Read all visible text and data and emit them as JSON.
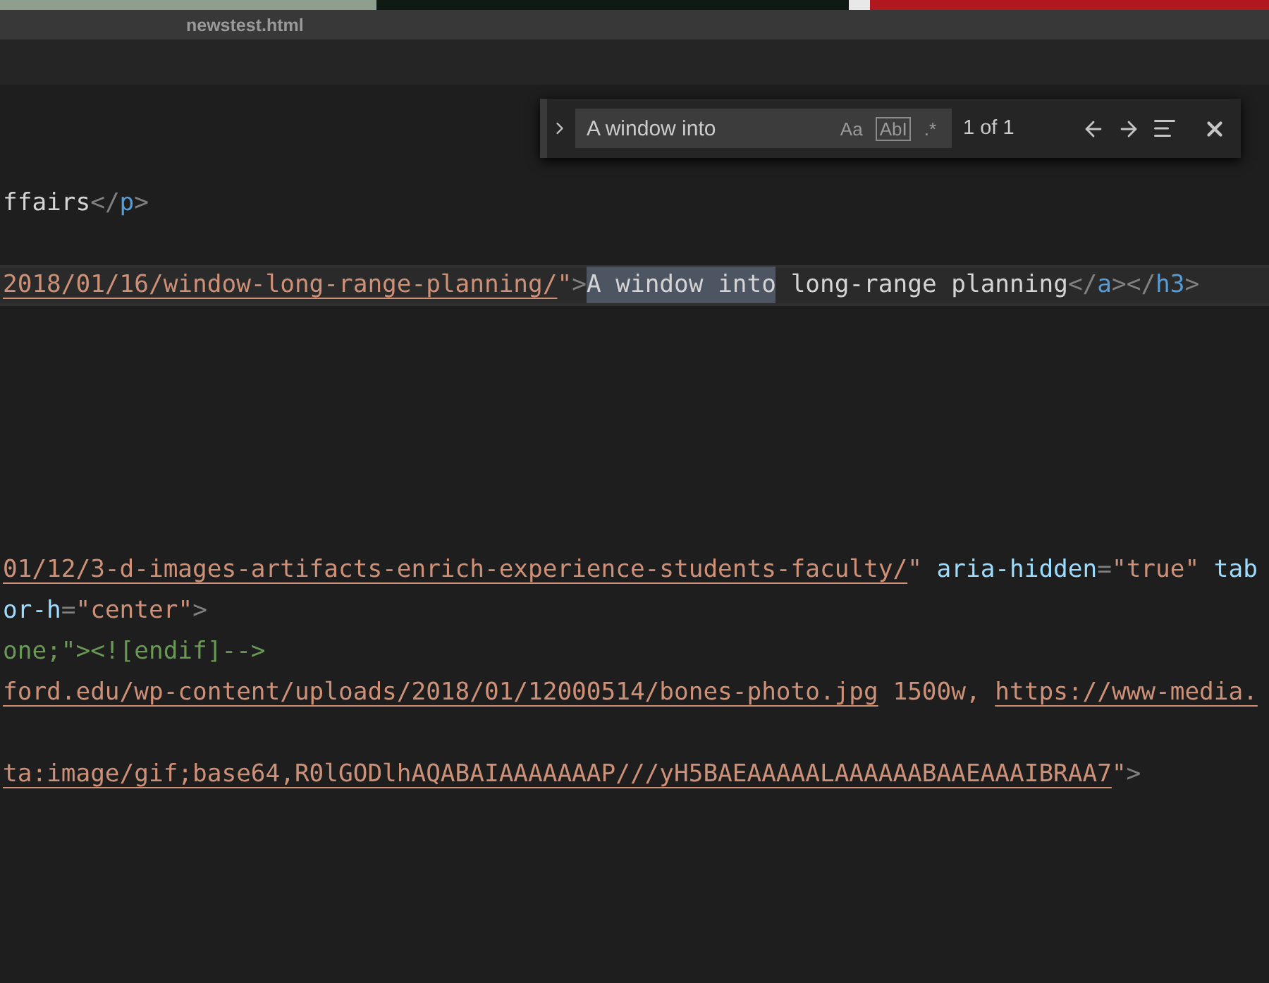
{
  "tab": {
    "title": "newstest.html"
  },
  "find": {
    "query": "A window into",
    "toggles": [
      {
        "label": "Aa",
        "selected": false
      },
      {
        "label": "AbI",
        "selected": true
      },
      {
        "label": ".*",
        "selected": false
      }
    ],
    "count": "1 of 1",
    "expanded": false
  },
  "lines": [
    {
      "current": false,
      "tokens": [
        {
          "kind": "text",
          "text": "ffairs"
        },
        {
          "kind": "punct",
          "text": "</"
        },
        {
          "kind": "tag",
          "text": "p"
        },
        {
          "kind": "punct",
          "text": ">"
        }
      ]
    },
    {
      "current": false
    },
    {
      "current": true,
      "tokens": [
        {
          "kind": "url",
          "text": "2018/01/16/window-long-range-planning/"
        },
        {
          "kind": "string",
          "text": "\""
        },
        {
          "kind": "punct",
          "text": ">"
        },
        {
          "kind": "match",
          "text": "A window into"
        },
        {
          "kind": "text",
          "text": " long-range planning"
        },
        {
          "kind": "punct",
          "text": "</"
        },
        {
          "kind": "tag",
          "text": "a"
        },
        {
          "kind": "punct",
          "text": "></"
        },
        {
          "kind": "tag",
          "text": "h3"
        },
        {
          "kind": "punct",
          "text": ">"
        }
      ]
    },
    {
      "current": false
    },
    {
      "current": false
    },
    {
      "current": false
    },
    {
      "current": false
    },
    {
      "current": false
    },
    {
      "current": false
    },
    {
      "current": false,
      "tokens": [
        {
          "kind": "url",
          "text": "01/12/3-d-images-artifacts-enrich-experience-students-faculty/"
        },
        {
          "kind": "string",
          "text": "\""
        },
        {
          "kind": "attr",
          "text": " aria-hidden"
        },
        {
          "kind": "punct",
          "text": "="
        },
        {
          "kind": "string",
          "text": "\"true\""
        },
        {
          "kind": "attr",
          "text": " tab"
        }
      ]
    },
    {
      "current": false,
      "tokens": [
        {
          "kind": "attr",
          "text": "or-h"
        },
        {
          "kind": "punct",
          "text": "="
        },
        {
          "kind": "string",
          "text": "\"center\""
        },
        {
          "kind": "punct",
          "text": ">"
        }
      ]
    },
    {
      "current": false,
      "tokens": [
        {
          "kind": "comment",
          "text": "one;\"><![endif]-->"
        }
      ]
    },
    {
      "current": false,
      "tokens": [
        {
          "kind": "url",
          "text": "ford.edu/wp-content/uploads/2018/01/12000514/bones-photo.jpg"
        },
        {
          "kind": "string",
          "text": " 1500w, "
        },
        {
          "kind": "url",
          "text": "https://www-media."
        }
      ]
    },
    {
      "current": false
    },
    {
      "current": false,
      "tokens": [
        {
          "kind": "url",
          "text": "ta:image/gif;base64,R0lGODlhAQABAIAAAAAAAP///yH5BAEAAAAALAAAAAABAAEAAAIBRAA7"
        },
        {
          "kind": "string",
          "text": "\""
        },
        {
          "kind": "punct",
          "text": ">"
        }
      ]
    }
  ]
}
